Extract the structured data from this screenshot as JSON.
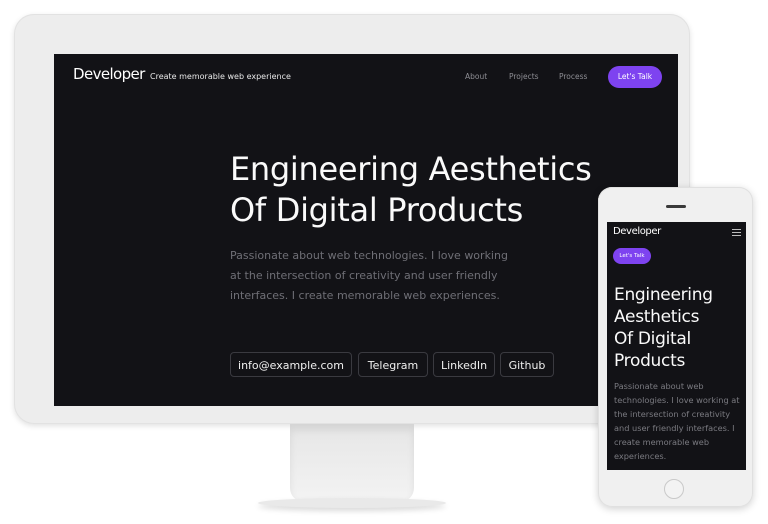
{
  "desktop": {
    "nav": {
      "logo": "Developer",
      "tagline": "Create memorable web experience",
      "links": [
        "About",
        "Projects",
        "Process"
      ],
      "cta": "Let's Talk"
    },
    "hero": {
      "headline_lines": [
        "Engineering Aesthetics",
        "Of Digital Products"
      ],
      "description_lines": [
        "Passionate about web technologies. I love working",
        "at the intersection of creativity and user friendly",
        "interfaces. I create memorable web experiences."
      ],
      "contacts": [
        "info@example.com",
        "Telegram",
        "LinkedIn",
        "Github"
      ]
    }
  },
  "mobile": {
    "logo": "Developer",
    "menu_icon": "hamburger-menu-icon",
    "cta": "Let's Talk",
    "headline_lines": [
      "Engineering",
      "Aesthetics",
      "Of Digital",
      "Products"
    ],
    "description_lines": [
      "Passionate about web",
      "technologies. I love working at",
      "the intersection of creativity",
      "and user friendly interfaces. I",
      "create memorable web",
      "experiences."
    ]
  },
  "colors": {
    "accent": "#7e43f0",
    "screen_bg": "#121216",
    "device_frame": "#ededed"
  }
}
